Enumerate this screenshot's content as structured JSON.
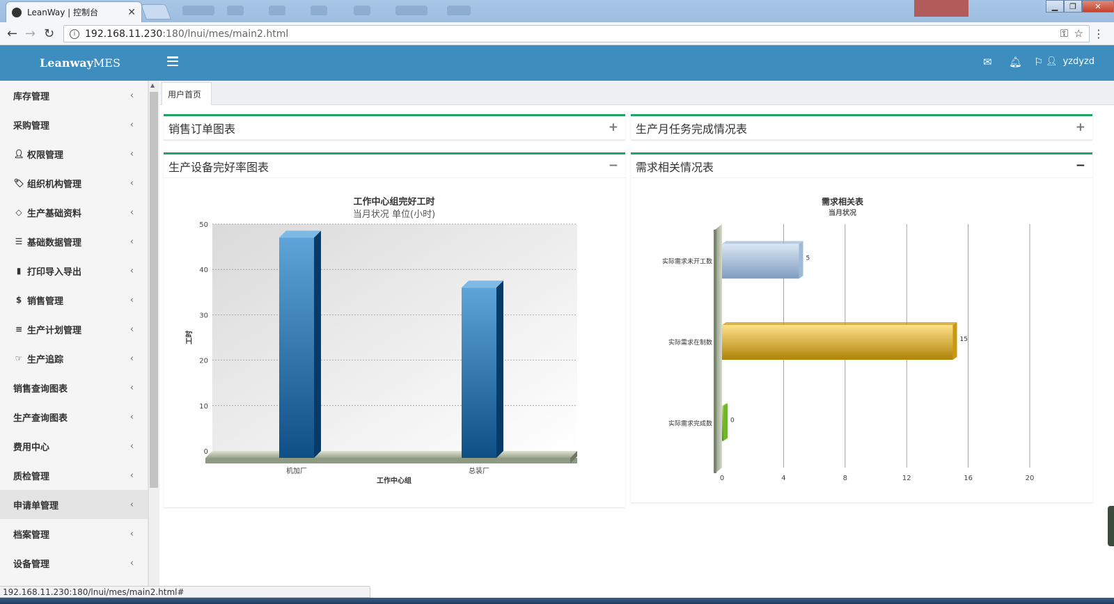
{
  "browser": {
    "tab_title": "LeanWay | 控制台",
    "url_host": "192.168.11.230",
    "url_path": ":180/lnui/mes/main2.html"
  },
  "app": {
    "brand_bold": "Leanway",
    "brand_rest": "MES",
    "username": "yzdyzd"
  },
  "sidebar": {
    "items": [
      {
        "label": "库存管理",
        "icon": ""
      },
      {
        "label": "采购管理",
        "icon": ""
      },
      {
        "label": "权限管理",
        "icon": "user-icon"
      },
      {
        "label": "组织机构管理",
        "icon": "tags-icon"
      },
      {
        "label": "生产基础资料",
        "icon": "code-icon"
      },
      {
        "label": "基础数据管理",
        "icon": "list-icon"
      },
      {
        "label": "打印导入导出",
        "icon": "file-icon"
      },
      {
        "label": "销售管理",
        "icon": "dollar-icon"
      },
      {
        "label": "生产计划管理",
        "icon": "bars-icon"
      },
      {
        "label": "生产追踪",
        "icon": "hand-point-icon"
      },
      {
        "label": "销售查询图表",
        "icon": ""
      },
      {
        "label": "生产查询图表",
        "icon": ""
      },
      {
        "label": "费用中心",
        "icon": ""
      },
      {
        "label": "质检管理",
        "icon": ""
      },
      {
        "label": "申请单管理",
        "icon": ""
      },
      {
        "label": "档案管理",
        "icon": ""
      },
      {
        "label": "设备管理",
        "icon": ""
      }
    ],
    "active_index": 14
  },
  "tabs": {
    "home": "用户首页"
  },
  "panels": {
    "sales_orders": {
      "title": "销售订单图表",
      "tool": "+"
    },
    "monthly_tasks": {
      "title": "生产月任务完成情况表",
      "tool": "+"
    },
    "equipment": {
      "title": "生产设备完好率图表",
      "tool": "−"
    },
    "demand": {
      "title": "需求相关情况表",
      "tool": "−"
    }
  },
  "status_text": "192.168.11.230:180/lnui/mes/main2.html#",
  "chart_data": [
    {
      "type": "bar",
      "title": "工作中心组完好工时",
      "subtitle": "当月状况 单位(小时)",
      "xlabel": "工作中心组",
      "ylabel": "工时",
      "categories": [
        "机加厂",
        "总装厂"
      ],
      "values": [
        47,
        36
      ],
      "ylim": [
        0,
        50
      ],
      "yticks": [
        0,
        10,
        20,
        30,
        40,
        50
      ],
      "grid": true,
      "color": "#1e6cab"
    },
    {
      "type": "bar",
      "orientation": "horizontal",
      "title": "需求相关表",
      "subtitle": "当月状况",
      "categories": [
        "实际需求未开工数",
        "实际需求在制数",
        "实际需求完成数"
      ],
      "values": [
        5,
        15,
        0
      ],
      "value_labels": [
        "5",
        "15",
        "0"
      ],
      "colors": [
        "#9fb9d8",
        "#c99a10",
        "#6fb82a"
      ],
      "xlim": [
        0,
        20
      ],
      "xticks": [
        0,
        4,
        8,
        12,
        16,
        20
      ],
      "grid": true
    }
  ]
}
